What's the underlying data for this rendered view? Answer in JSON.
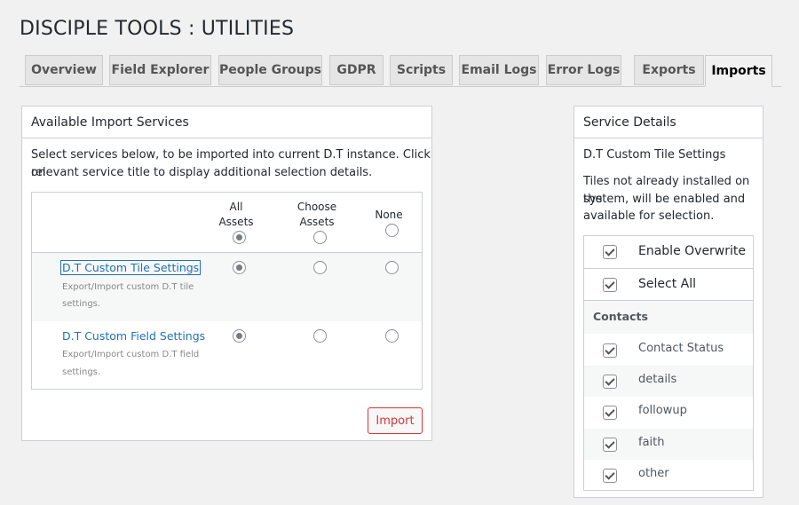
{
  "page": {
    "title": "DISCIPLE TOOLS : UTILITIES"
  },
  "tabs": [
    {
      "label": "Overview"
    },
    {
      "label": "Field Explorer"
    },
    {
      "label": "People Groups"
    },
    {
      "label": "GDPR"
    },
    {
      "label": "Scripts"
    },
    {
      "label": "Email Logs"
    },
    {
      "label": "Error Logs"
    },
    {
      "label": "Exports"
    },
    {
      "label": "Imports",
      "active": true
    }
  ],
  "import_services": {
    "heading": "Available Import Services",
    "description_line1": "Select services below, to be imported into current D.T instance. Click on",
    "description_line2": "relevant service title to display additional selection details.",
    "columns": {
      "all_line1": "All",
      "all_line2": "Assets",
      "choose_line1": "Choose",
      "choose_line2": "Assets",
      "none": "None"
    },
    "services": [
      {
        "title": "D.T Custom Tile Settings",
        "desc_line1": "Export/Import custom D.T tile",
        "desc_line2": "settings.",
        "selected": "all"
      },
      {
        "title": "D.T Custom Field Settings",
        "desc_line1": "Export/Import custom D.T field",
        "desc_line2": "settings.",
        "selected": "all"
      }
    ],
    "import_button": "Import"
  },
  "service_details": {
    "heading": "Service Details",
    "service_name": "D.T Custom Tile Settings",
    "note_line1": "Tiles not already installed on the",
    "note_line2": "system, will be enabled and",
    "note_line3": "available for selection.",
    "enable_overwrite": "Enable Overwrite",
    "select_all": "Select All",
    "group_label": "Contacts",
    "items": [
      "Contact Status",
      "details",
      "followup",
      "faith",
      "other"
    ]
  }
}
